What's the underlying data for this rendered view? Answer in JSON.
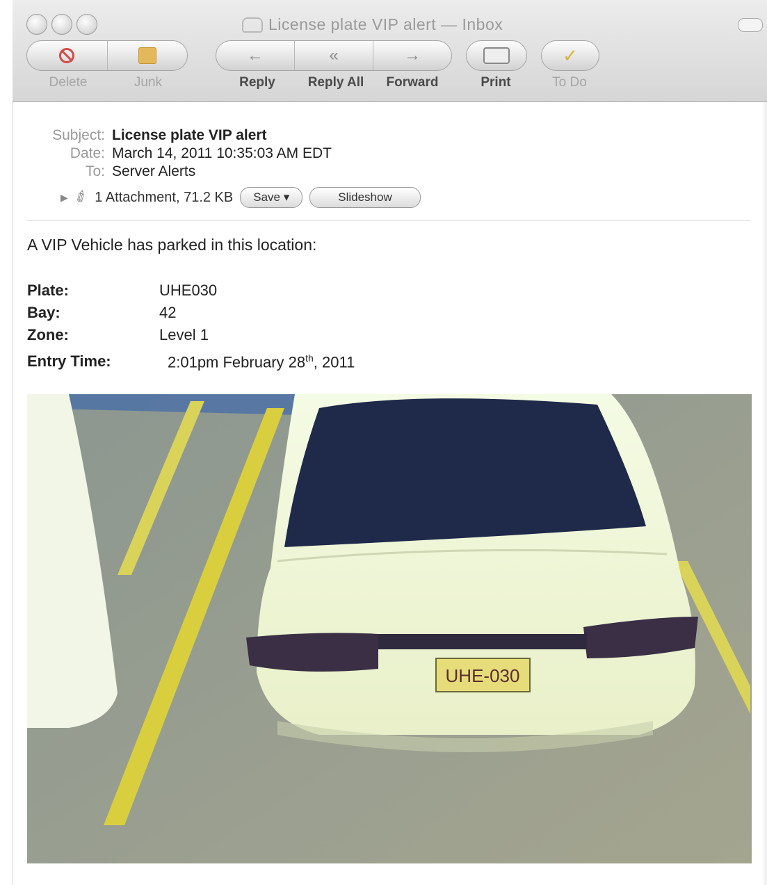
{
  "window": {
    "title": "License plate VIP alert — Inbox"
  },
  "toolbar": {
    "delete_label": "Delete",
    "junk_label": "Junk",
    "reply_label": "Reply",
    "reply_all_label": "Reply All",
    "forward_label": "Forward",
    "print_label": "Print",
    "todo_label": "To Do"
  },
  "headers": {
    "subject_key": "Subject:",
    "subject": "License plate VIP alert",
    "date_key": "Date:",
    "date": "March 14, 2011 10:35:03 AM EDT",
    "to_key": "To:",
    "to": "Server Alerts",
    "attachment": "1 Attachment, 71.2 KB",
    "save_label": "Save ▾",
    "slideshow_label": "Slideshow"
  },
  "body": {
    "intro": "A VIP Vehicle has parked in this location:",
    "fields": [
      {
        "key": "Plate:",
        "value": "UHE030"
      },
      {
        "key": "Bay:",
        "value": "42"
      },
      {
        "key": "Zone:",
        "value": "Level 1"
      }
    ],
    "entry_key": "Entry Time:",
    "entry_time_pre": "2:01pm February 28",
    "entry_time_sup": "th",
    "entry_time_post": ", 2011"
  },
  "photo": {
    "plate_text": "UHE-030"
  }
}
